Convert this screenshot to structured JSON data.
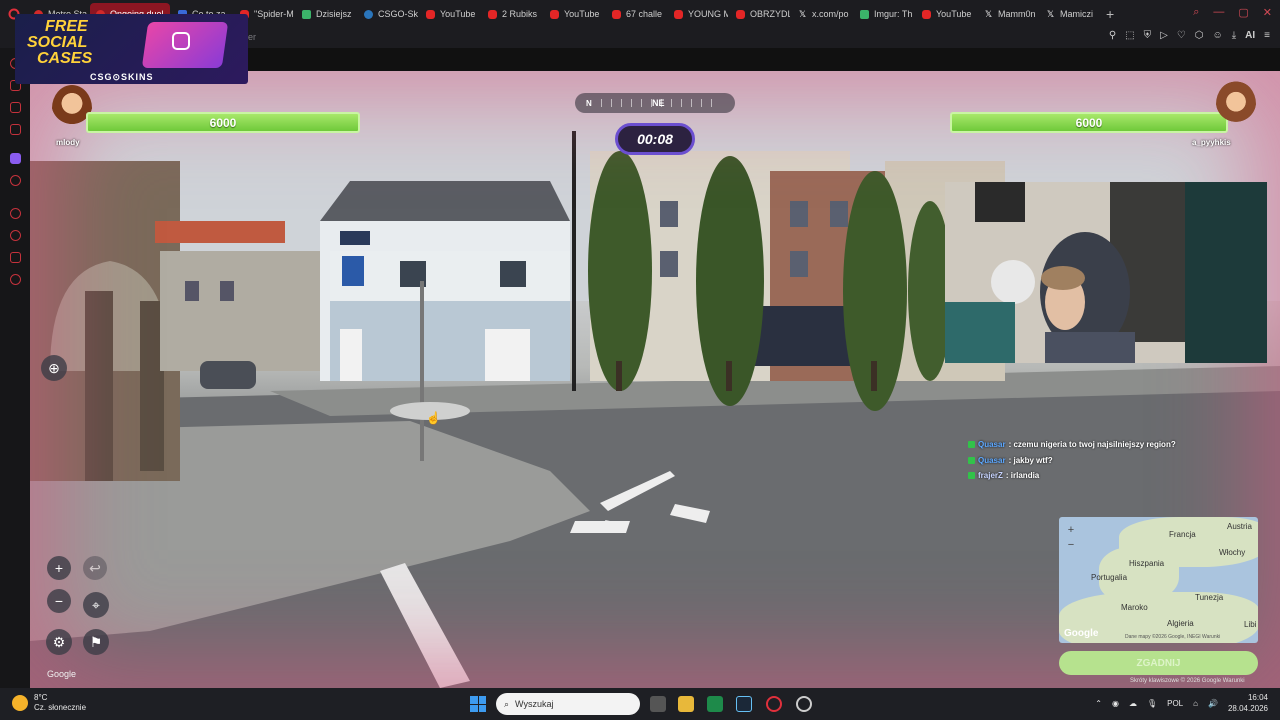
{
  "browser": {
    "tabs": [
      {
        "label": "Metro Sta",
        "icon": "red"
      },
      {
        "label": "Ongoing duel",
        "icon": "red",
        "active": true
      },
      {
        "label": "Co to za",
        "icon": "blue"
      },
      {
        "label": "\"Spider-M",
        "icon": "yt"
      },
      {
        "label": "Dzisiejsz",
        "icon": "img"
      },
      {
        "label": "CSGO-Sk",
        "icon": "steam"
      },
      {
        "label": "YouTube",
        "icon": "yt"
      },
      {
        "label": "2 Rubiks",
        "icon": "yt"
      },
      {
        "label": "YouTube",
        "icon": "yt"
      },
      {
        "label": "67 challe",
        "icon": "yt"
      },
      {
        "label": "YOUNG M",
        "icon": "yt"
      },
      {
        "label": "OBRZYDL",
        "icon": "yt"
      },
      {
        "label": "x.com/po",
        "icon": "x"
      },
      {
        "label": "Imgur: Th",
        "icon": "img"
      },
      {
        "label": "YouTube",
        "icon": "yt"
      },
      {
        "label": "Mamm0n",
        "icon": "x"
      },
      {
        "label": "Mamiczi",
        "icon": "x"
      }
    ],
    "new_tab": "+",
    "url_fragment": "er",
    "ai_label": "AI"
  },
  "promo": {
    "headline_line1": "FREE",
    "headline_line2": "SOCIAL",
    "headline_line3": "CASES",
    "brand": "CSG⊙SKINS"
  },
  "game": {
    "player_left": {
      "name": "mlody",
      "score": "6000"
    },
    "player_right": {
      "name": "a_pyyhkis",
      "score": "6000"
    },
    "compass": {
      "left": "N",
      "center": "NE"
    },
    "timer": "00:08",
    "chat": [
      {
        "nick": "Quasar",
        "text": ": czemu nigeria to twoj najsilniejszy region?"
      },
      {
        "nick": "Quasar",
        "text": ": jakby wtf?"
      },
      {
        "nick": "frajerZ",
        "text": ": irlandia"
      }
    ],
    "map": {
      "labels": [
        "Francja",
        "Austria",
        "Włochy",
        "Hiszpania",
        "Portugalia",
        "Maroko",
        "Tunezja",
        "Algieria",
        "Libi"
      ],
      "zoom_in": "+",
      "zoom_out": "−",
      "google": "Google",
      "footer": "Dane mapy ©2026 Google, INEGI   Warunki"
    },
    "guess_button": "ZGADNIJ",
    "attribution": "Skróty klawiszowe   © 2026 Google   Warunki",
    "google_mark": "Google",
    "controls": {
      "zoom_in": "+",
      "zoom_out": "−",
      "undo": "↩"
    }
  },
  "taskbar": {
    "temperature": "8°C",
    "weather": "Cz. słonecznie",
    "search_placeholder": "Wyszukaj",
    "language": "POL",
    "time": "16:04",
    "date": "28.04.2026"
  },
  "colors": {
    "accent": "#8d1622",
    "health": "#6fc93a",
    "timer_border": "#6b4fd0"
  }
}
